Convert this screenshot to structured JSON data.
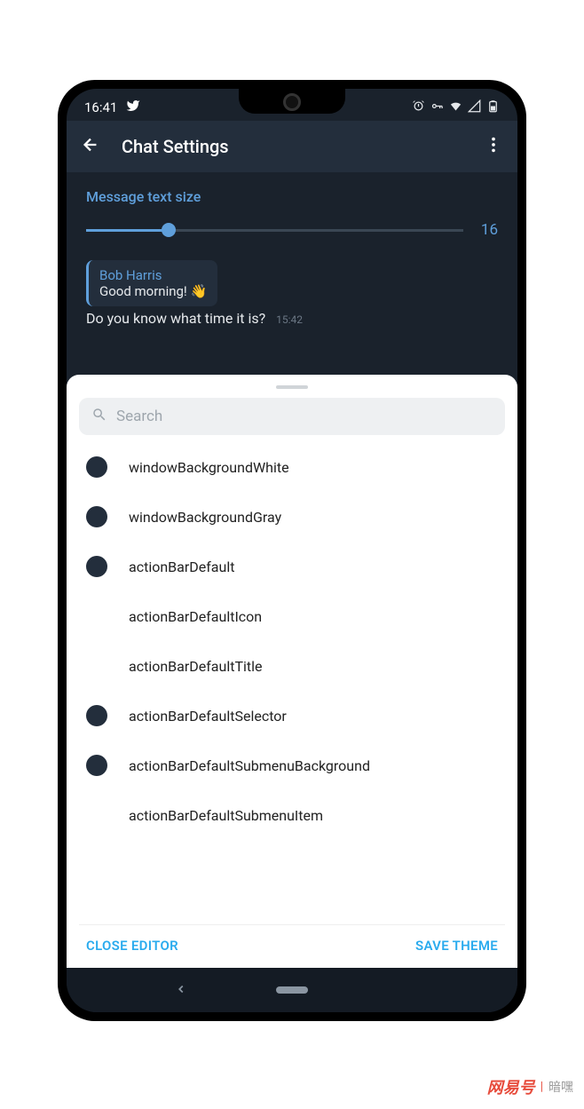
{
  "status": {
    "time": "16:41"
  },
  "appbar": {
    "title": "Chat Settings"
  },
  "textSize": {
    "label": "Message text size",
    "value": "16"
  },
  "preview": {
    "name": "Bob Harris",
    "reply": "Good morning! 👋",
    "msg": "Do you know what time it is?",
    "time": "15:42"
  },
  "search": {
    "placeholder": "Search"
  },
  "themeItems": [
    {
      "label": "windowBackgroundWhite",
      "swatch": true
    },
    {
      "label": "windowBackgroundGray",
      "swatch": true
    },
    {
      "label": "actionBarDefault",
      "swatch": true
    },
    {
      "label": "actionBarDefaultIcon",
      "swatch": false
    },
    {
      "label": "actionBarDefaultTitle",
      "swatch": false
    },
    {
      "label": "actionBarDefaultSelector",
      "swatch": true
    },
    {
      "label": "actionBarDefaultSubmenuBackground",
      "swatch": true
    },
    {
      "label": "actionBarDefaultSubmenuItem",
      "swatch": false
    }
  ],
  "actions": {
    "close": "CLOSE EDITOR",
    "save": "SAVE THEME"
  },
  "watermark": {
    "brand": "网易号",
    "text": "暗嘿"
  }
}
